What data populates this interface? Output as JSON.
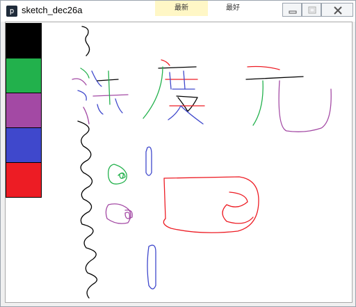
{
  "window": {
    "title": "sketch_dec26a",
    "app_icon_glyph": "p",
    "background_tabs": [
      "最新",
      "最好"
    ]
  },
  "controls": {
    "minimize_icon": "minimize-icon",
    "maximize_icon": "maximize-icon",
    "close_icon": "close-icon"
  },
  "palette": {
    "colors": [
      {
        "name": "black",
        "hex": "#000000"
      },
      {
        "name": "green",
        "hex": "#22b14c"
      },
      {
        "name": "purple",
        "hex": "#a349a4"
      },
      {
        "name": "blue",
        "hex": "#3f48cc"
      },
      {
        "name": "red",
        "hex": "#ed1c24"
      }
    ]
  }
}
